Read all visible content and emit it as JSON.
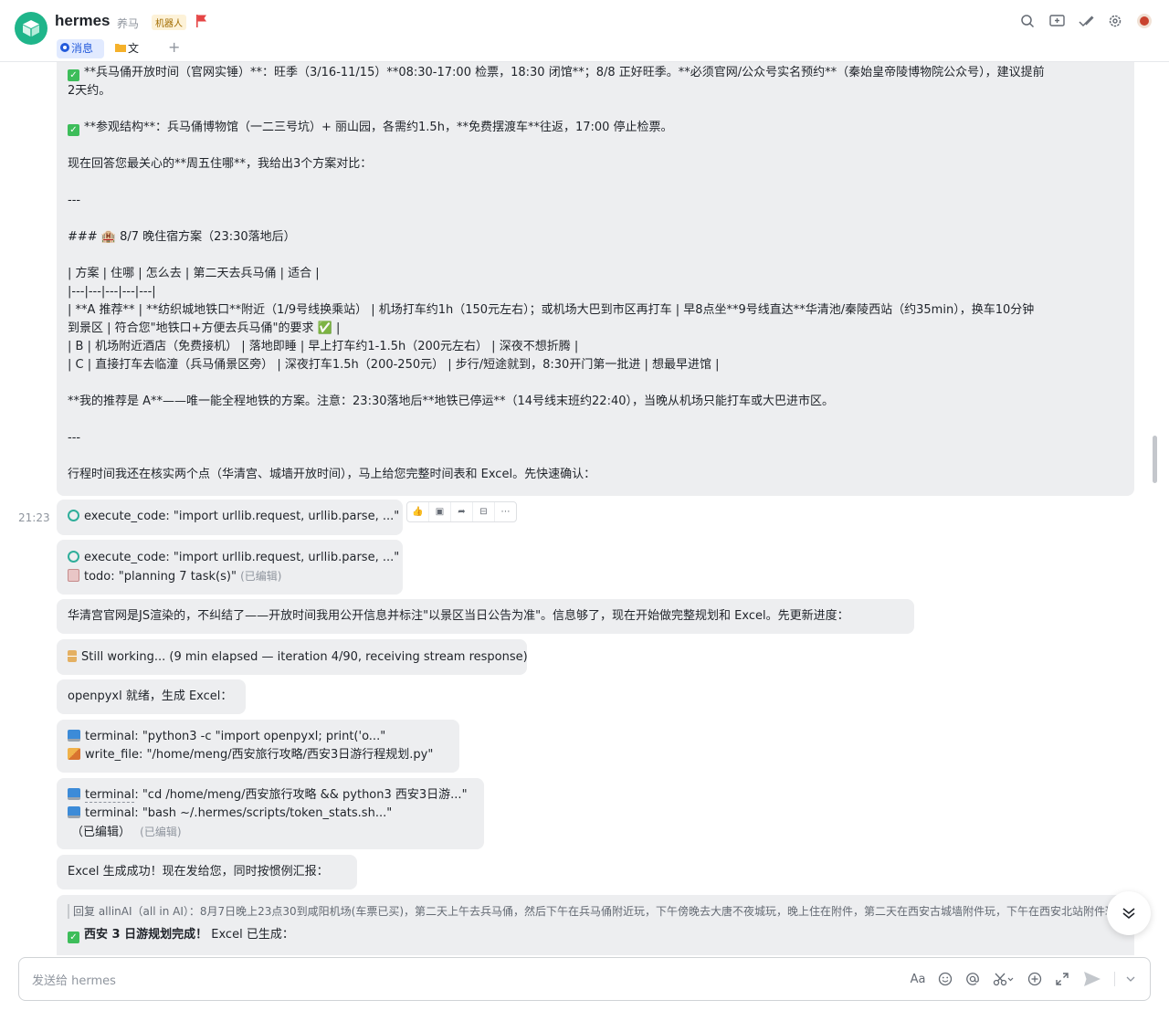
{
  "header": {
    "title": "hermes",
    "alias": "养马",
    "bot_badge": "机器人",
    "tabs": [
      {
        "label": "消息"
      },
      {
        "label": "文件"
      }
    ],
    "add_tab": "+"
  },
  "colors": {
    "accent": "#245bdb",
    "logo": "#1fb58a",
    "bubble": "#edeef0",
    "check": "#3dbd5a"
  },
  "chat": {
    "big_message": {
      "lines": [
        "**兵马俑开放时间（官网实锤）**：旺季（3/16-11/15）**08:30-17:00 检票，18:30 闭馆**；8/8 正好旺季。**必须官网/公众号实名预约**（秦始皇帝陵博物院公众号），建议提前",
        "2天约。",
        "",
        "**参观结构**：兵马俑博物馆（一二三号坑）+ 丽山园，各需约1.5h，**免费摆渡车**往返，17:00 停止检票。",
        "",
        "现在回答您最关心的**周五住哪**，我给出3个方案对比：",
        "",
        "---",
        "",
        "### 🏨 8/7 晚住宿方案（23:30落地后）",
        "",
        "| 方案 | 住哪 | 怎么去 | 第二天去兵马俑 | 适合 |",
        "|---|---|---|---|---|",
        "| **A 推荐** | **纺织城地铁口**附近（1/9号线换乘站） | 机场打车约1h（150元左右）；或机场大巴到市区再打车 | 早8点坐**9号线直达**华清池/秦陵西站（约35min），换车10分钟",
        "到景区 | 符合您\"地铁口+方便去兵马俑\"的要求 ✅ |",
        "| B | 机场附近酒店（免费接机） | 落地即睡 | 早上打车约1-1.5h（200元左右） | 深夜不想折腾 |",
        "| C | 直接打车去临潼（兵马俑景区旁） | 深夜打车1.5h（200-250元） | 步行/短途就到，8:30开门第一批进 | 想最早进馆 |",
        "",
        "**我的推荐是 A**——唯一能全程地铁的方案。注意：23:30落地后**地铁已停运**（14号线末班约22:40），当晚从机场只能打车或大巴进市区。",
        "",
        "---",
        "",
        "行程时间我还在核实两个点（华清宫、城墙开放时间），马上给您完整时间表和 Excel。先快速确认："
      ]
    },
    "timestamp": "21:23",
    "tool1": "execute_code: \"import urllib.request, urllib.parse, ...\"",
    "tool2": {
      "line1": "execute_code: \"import urllib.request, urllib.parse, ...\"",
      "line2": "todo: \"planning 7 task(s)\"",
      "edited": "(已编辑)"
    },
    "msg_huaqing": "华清宫官网是JS渲染的，不纠结了——开放时间我用公开信息并标注\"以景区当日公告为准\"。信息够了，现在开始做完整规划和 Excel。先更新进度：",
    "still_working": "Still working... (9 min elapsed — iteration 4/90, receiving stream response)",
    "msg_openpyxl": "openpyxl 就绪，生成 Excel：",
    "tool3": {
      "line1": "terminal: \"python3 -c \"import openpyxl; print('o...\"",
      "line2": "write_file: \"/home/meng/西安旅行攻略/西安3日游行程规划.py\""
    },
    "tool4": {
      "line1_prefix": "terminal",
      "line1_rest": ": \"cd /home/meng/西安旅行攻略 && python3 西安3日游...\"",
      "line2": "terminal: \"bash ~/.hermes/scripts/token_stats.sh...\"",
      "line3": "（已编辑）",
      "edited": "(已编辑)"
    },
    "msg_excel": "Excel 生成成功！现在发给您，同时按惯例汇报：",
    "last": {
      "reply_quote": "回复 allinAI（all in AI）：8月7日晚上23点30到咸阳机场(车票已买)，第二天上午去兵马俑，然后下午在兵马俑附近玩，下午傍晚去大唐不夜城玩，晚上住在附件，第二天在西安古城墙附件玩，下午在西安北站附件玩",
      "title": "西安 3 日游规划完成！",
      "title_rest": "Excel 已生成："
    }
  },
  "composer": {
    "placeholder": "发送给 hermes",
    "font_tool": "Aa"
  }
}
